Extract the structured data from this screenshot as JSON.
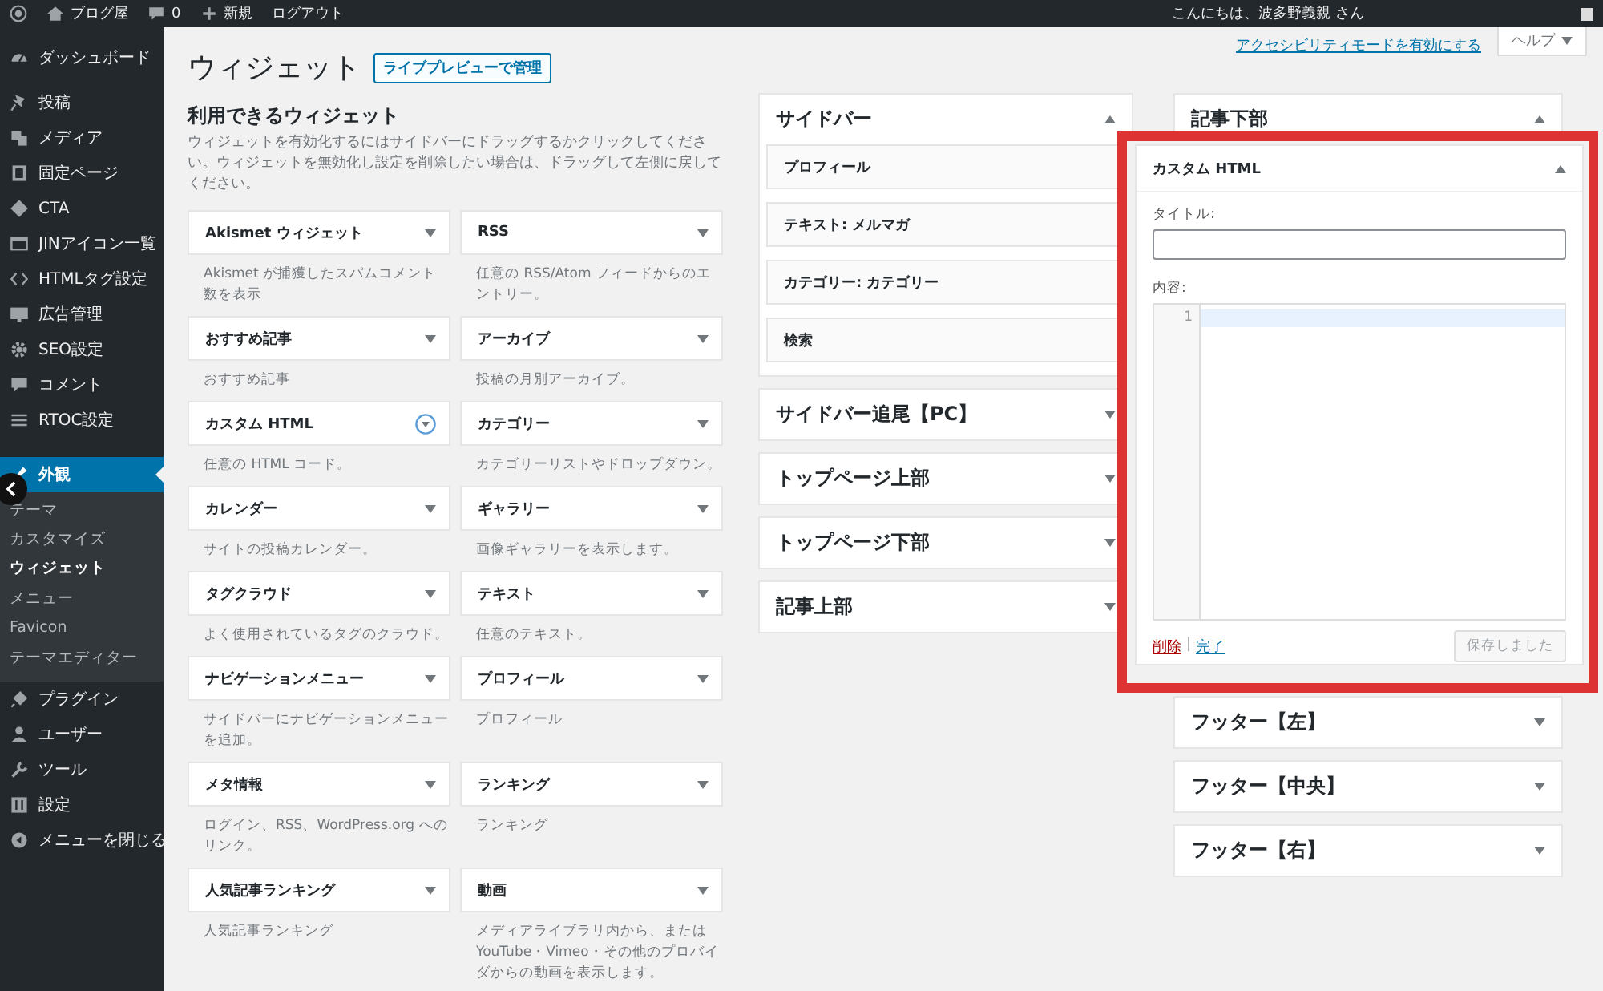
{
  "admin_bar": {
    "site": "ブログ屋",
    "comments": "0",
    "new": "新規",
    "logout": "ログアウト",
    "greeting": "こんにちは、波多野義親 さん"
  },
  "sidebar": {
    "groups": [
      [
        {
          "label": "ダッシュボード",
          "selected": false
        }
      ],
      [
        {
          "label": "投稿",
          "selected": false
        },
        {
          "label": "メディア",
          "selected": false
        },
        {
          "label": "固定ページ",
          "selected": false
        },
        {
          "label": "CTA",
          "selected": false
        },
        {
          "label": "JINアイコン一覧",
          "selected": false
        },
        {
          "label": "HTMLタグ設定",
          "selected": false
        },
        {
          "label": "広告管理",
          "selected": false
        },
        {
          "label": "SEO設定",
          "selected": false
        },
        {
          "label": "コメント",
          "selected": false
        },
        {
          "label": "RTOC設定",
          "selected": false
        }
      ],
      [
        {
          "label": "外観",
          "selected": true,
          "children": [
            {
              "label": "テーマ",
              "selected": false
            },
            {
              "label": "カスタマイズ",
              "selected": false
            },
            {
              "label": "ウィジェット",
              "selected": true
            },
            {
              "label": "メニュー",
              "selected": false
            },
            {
              "label": "Favicon",
              "selected": false
            },
            {
              "label": "テーマエディター",
              "selected": false
            }
          ]
        },
        {
          "label": "プラグイン",
          "selected": false
        },
        {
          "label": "ユーザー",
          "selected": false
        },
        {
          "label": "ツール",
          "selected": false
        },
        {
          "label": "設定",
          "selected": false
        }
      ]
    ],
    "collapse": "メニューを閉じる"
  },
  "screen_meta": {
    "accessibility_link": "アクセシビリティモードを有効にする",
    "help": "ヘルプ"
  },
  "page": {
    "title": "ウィジェット",
    "action": "ライブプレビューで管理"
  },
  "available": {
    "heading": "利用できるウィジェット",
    "description": "ウィジェットを有効化するにはサイドバーにドラッグするかクリックしてください。ウィジェットを無効化し設定を削除したい場合は、ドラッグして左側に戻してください。",
    "widgets": [
      {
        "name": "Akismet ウィジェット",
        "description": "Akismet が捕獲したスパムコメント数を表示",
        "focused": false
      },
      {
        "name": "RSS",
        "description": "任意の RSS/Atom フィードからのエントリー。",
        "focused": false
      },
      {
        "name": "おすすめ記事",
        "description": "おすすめ記事",
        "focused": false
      },
      {
        "name": "アーカイブ",
        "description": "投稿の月別アーカイブ。",
        "focused": false
      },
      {
        "name": "カスタム HTML",
        "description": "任意の HTML コード。",
        "focused": true
      },
      {
        "name": "カテゴリー",
        "description": "カテゴリーリストやドロップダウン。",
        "focused": false
      },
      {
        "name": "カレンダー",
        "description": "サイトの投稿カレンダー。",
        "focused": false
      },
      {
        "name": "ギャラリー",
        "description": "画像ギャラリーを表示します。",
        "focused": false
      },
      {
        "name": "タグクラウド",
        "description": "よく使用されているタグのクラウド。",
        "focused": false
      },
      {
        "name": "テキスト",
        "description": "任意のテキスト。",
        "focused": false
      },
      {
        "name": "ナビゲーションメニュー",
        "description": "サイドバーにナビゲーションメニューを追加。",
        "focused": false
      },
      {
        "name": "プロフィール",
        "description": "プロフィール",
        "focused": false
      },
      {
        "name": "メタ情報",
        "description": "ログイン、RSS、WordPress.org へのリンク。",
        "focused": false
      },
      {
        "name": "ランキング",
        "description": "ランキング",
        "focused": false
      },
      {
        "name": "人気記事ランキング",
        "description": "人気記事ランキング",
        "focused": false
      },
      {
        "name": "動画",
        "description": "メディアライブラリ内から、または YouTube・Vimeo・その他のプロバイダからの動画を表示します。",
        "focused": false
      }
    ]
  },
  "area_columns": [
    [
      {
        "name": "サイドバー",
        "expanded": true,
        "widgets": [
          "プロフィール",
          "テキスト: メルマガ",
          "カテゴリー: カテゴリー",
          "検索"
        ]
      },
      {
        "name": "サイドバー追尾【PC】",
        "expanded": false
      },
      {
        "name": "トップページ上部",
        "expanded": false
      },
      {
        "name": "トップページ下部",
        "expanded": false
      },
      {
        "name": "記事上部",
        "expanded": false
      }
    ],
    [
      {
        "name": "記事下部",
        "expanded": true
      },
      {
        "name": "フッター【左】",
        "expanded": false
      },
      {
        "name": "フッター【中央】",
        "expanded": false
      },
      {
        "name": "フッター【右】",
        "expanded": false
      }
    ]
  ],
  "editor": {
    "title": "カスタム HTML",
    "title_label": "タイトル:",
    "content_label": "内容:",
    "line_number": "1",
    "delete": "削除",
    "separator": "|",
    "done": "完了",
    "save": "保存しました",
    "save_disabled": true
  }
}
